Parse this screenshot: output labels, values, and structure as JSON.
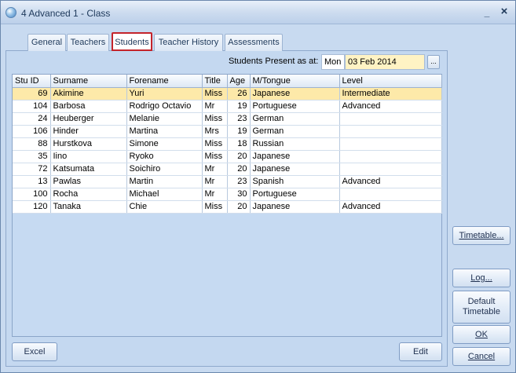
{
  "window": {
    "title": "4 Advanced 1 - Class",
    "minimize_glyph": "_",
    "close_glyph": "×"
  },
  "tabs": [
    {
      "label": "General"
    },
    {
      "label": "Teachers"
    },
    {
      "label": "Students"
    },
    {
      "label": "Teacher History"
    },
    {
      "label": "Assessments"
    }
  ],
  "active_tab": "Students",
  "present": {
    "label": "Students Present as at:",
    "day": "Mon",
    "date": "03 Feb 2014",
    "picker_glyph": "..."
  },
  "table": {
    "columns": [
      "Stu ID",
      "Surname",
      "Forename",
      "Title",
      "Age",
      "M/Tongue",
      "Level"
    ],
    "rows": [
      [
        "69",
        "Akimine",
        "Yuri",
        "Miss",
        "26",
        "Japanese",
        "Intermediate"
      ],
      [
        "104",
        "Barbosa",
        "Rodrigo Octavio",
        "Mr",
        "19",
        "Portuguese",
        "Advanced"
      ],
      [
        "24",
        "Heuberger",
        "Melanie",
        "Miss",
        "23",
        "German",
        ""
      ],
      [
        "106",
        "Hinder",
        "Martina",
        "Mrs",
        "19",
        "German",
        ""
      ],
      [
        "88",
        "Hurstkova",
        "Simone",
        "Miss",
        "18",
        "Russian",
        ""
      ],
      [
        "35",
        "Iino",
        "Ryoko",
        "Miss",
        "20",
        "Japanese",
        ""
      ],
      [
        "72",
        "Katsumata",
        "Soichiro",
        "Mr",
        "20",
        "Japanese",
        ""
      ],
      [
        "13",
        "Pawlas",
        "Martin",
        "Mr",
        "23",
        "Spanish",
        "Advanced"
      ],
      [
        "100",
        "Rocha",
        "Michael",
        "Mr",
        "30",
        "Portuguese",
        ""
      ],
      [
        "120",
        "Tanaka",
        "Chie",
        "Miss",
        "20",
        "Japanese",
        "Advanced"
      ]
    ],
    "selected_row": 0
  },
  "buttons": {
    "excel": "Excel",
    "edit": "Edit",
    "timetable": "Timetable...",
    "log": "Log...",
    "default_timetable_line1": "Default",
    "default_timetable_line2": "Timetable",
    "ok": "OK",
    "cancel": "Cancel"
  },
  "colors": {
    "selected_row": "#fde9a9",
    "active_tab_border": "#c4242b",
    "panel_bg": "#c4d8f0"
  }
}
